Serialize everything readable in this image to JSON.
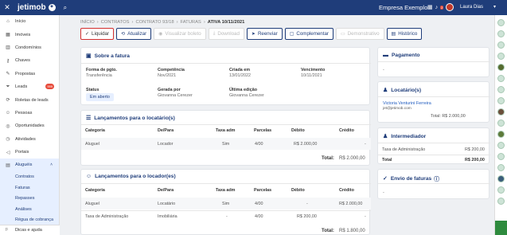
{
  "topbar": {
    "logo": "jetimob",
    "logo_badge": "✦",
    "company": "Empresa Exemplo",
    "notif_count": "2",
    "user": "Laura Dias"
  },
  "sidebar": {
    "items": [
      {
        "label": "Início",
        "icon": "home-icon",
        "glyph": "⌂"
      },
      {
        "label": "Imóveis",
        "icon": "building-icon",
        "glyph": "▦"
      },
      {
        "label": "Condomínios",
        "icon": "condo-icon",
        "glyph": "▥"
      },
      {
        "label": "Chaves",
        "icon": "key-icon",
        "glyph": "⚷"
      },
      {
        "label": "Propostas",
        "icon": "pen-icon",
        "glyph": "✎"
      },
      {
        "label": "Leads",
        "icon": "funnel-icon",
        "glyph": "⏷",
        "badge": "999"
      },
      {
        "label": "Roletas de leads",
        "icon": "roulette-icon",
        "glyph": "⟳"
      },
      {
        "label": "Pessoas",
        "icon": "people-icon",
        "glyph": "☺"
      },
      {
        "label": "Oportunidades",
        "icon": "opportunity-icon",
        "glyph": "◎"
      },
      {
        "label": "Atividades",
        "icon": "activity-icon",
        "glyph": "◷"
      },
      {
        "label": "Portais",
        "icon": "megaphone-icon",
        "glyph": "◁"
      },
      {
        "label": "Aluguéis",
        "icon": "rent-icon",
        "glyph": "▤"
      }
    ],
    "subitems": [
      "Contratos",
      "Faturas",
      "Repasses",
      "Análises",
      "Régua de cobrança"
    ],
    "bottom": "Dicas e ajuda"
  },
  "breadcrumb": [
    "INÍCIO",
    "CONTRATOS",
    "CONTRATO 93/18",
    "FATURAS",
    "ATIVA 10/11/2021"
  ],
  "toolbar": {
    "liquidar": "Liquidar",
    "atualizar": "Atualizar",
    "visualizar": "Visualizar boleto",
    "download": "Download",
    "reenviar": "Reenviar",
    "complementar": "Complementar",
    "demonstrativo": "Demonstrativo",
    "historico": "Histórico"
  },
  "sobre": {
    "title": "Sobre a fatura",
    "forma_label": "Forma de pgto.",
    "forma_value": "Transferência",
    "competencia_label": "Competência",
    "competencia_value": "Nov/2021",
    "criada_label": "Criada em",
    "criada_value": "13/01/2022",
    "vencimento_label": "Vencimento",
    "vencimento_value": "10/11/2021",
    "status_label": "Status",
    "status_value": "Em aberto",
    "gerada_label": "Gerada por",
    "gerada_value": "Giovanna Cerezer",
    "edicao_label": "Última edição",
    "edicao_value": "Giovanna Cerezer"
  },
  "locatario_table": {
    "title": "Lançamentos para o locatário(s)",
    "headers": [
      "Categoria",
      "De/Para",
      "Taxa adm",
      "Parcelas",
      "Débito",
      "Crédito"
    ],
    "rows": [
      [
        "Aluguel",
        "Locador",
        "Sim",
        "4/00",
        "R$ 2.000,00",
        "-"
      ]
    ],
    "total_label": "Total:",
    "total_value": "R$ 2.000,00"
  },
  "locador_table": {
    "title": "Lançamentos para o locador(es)",
    "headers": [
      "Categoria",
      "De/Para",
      "Taxa adm",
      "Parcelas",
      "Débito",
      "Crédito"
    ],
    "rows": [
      [
        "Aluguel",
        "Locatário",
        "Sim",
        "4/00",
        "-",
        "R$ 2.000,00"
      ],
      [
        "Taxa de Administração",
        "Imobiliária",
        "-",
        "4/00",
        "R$ 200,00",
        "-"
      ]
    ],
    "total_label": "Total:",
    "total_value": "R$ 1.800,00"
  },
  "pagamento": {
    "title": "Pagamento",
    "value": "-"
  },
  "locatarios": {
    "title": "Locatário(s)",
    "name": "Victoria Venturini Ferreira",
    "email": "jet@jetimob.com",
    "total": "Total: R$ 2.000,00"
  },
  "intermediador": {
    "title": "Intermediador",
    "row1_label": "Taxa de Administração",
    "row1_value": "R$ 200,00",
    "row2_label": "Total",
    "row2_value": "R$ 200,00"
  },
  "envio": {
    "title": "Envio de faturas",
    "value": "-"
  }
}
